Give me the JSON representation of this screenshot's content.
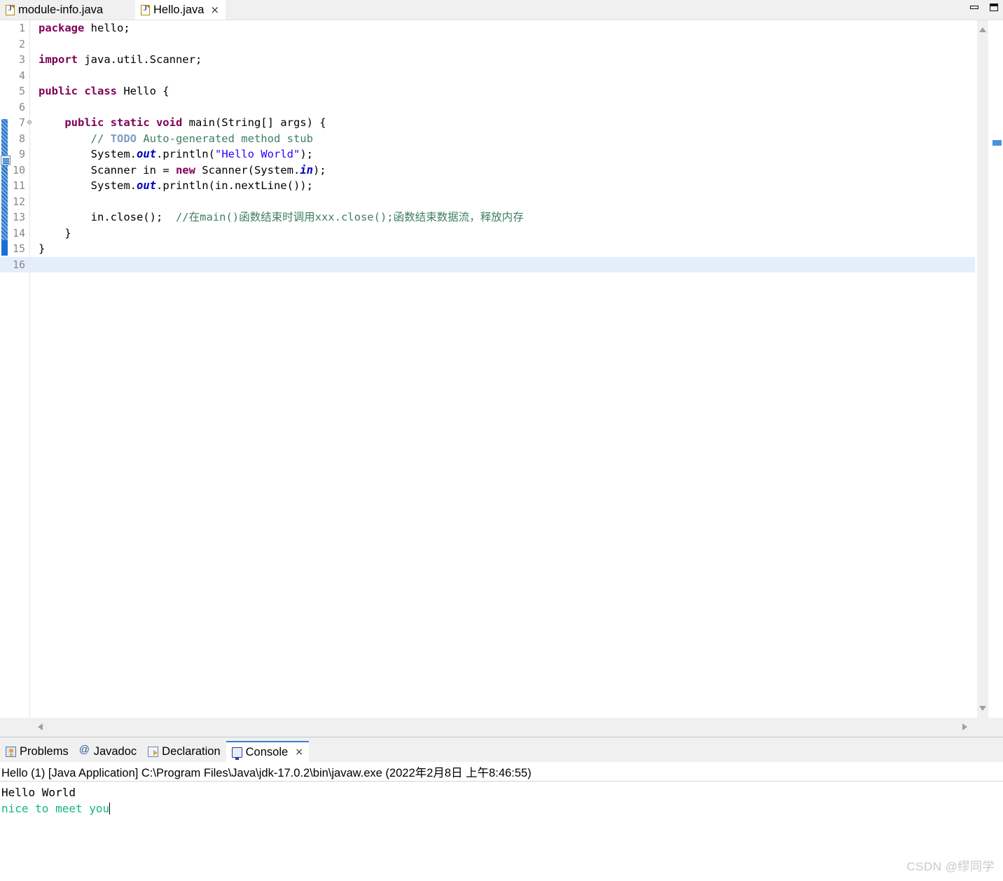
{
  "window": {
    "minimize_label": "Minimize",
    "maximize_label": "Maximize"
  },
  "editor_tabs": [
    {
      "label": "module-info.java",
      "icon": "java-file-icon",
      "active": false,
      "closable": false
    },
    {
      "label": "Hello.java",
      "icon": "java-file-icon",
      "active": true,
      "closable": true,
      "close_glyph": "×"
    }
  ],
  "editor": {
    "file": "Hello.java",
    "current_line": 16,
    "fold_marker": "⊖",
    "lines": [
      {
        "n": "1",
        "fold": "",
        "tokens": [
          {
            "t": "package",
            "c": "kw"
          },
          {
            "t": " hello;",
            "c": "plain"
          }
        ]
      },
      {
        "n": "2",
        "fold": "",
        "tokens": []
      },
      {
        "n": "3",
        "fold": "",
        "tokens": [
          {
            "t": "import",
            "c": "kw"
          },
          {
            "t": " java.util.Scanner;",
            "c": "plain"
          }
        ]
      },
      {
        "n": "4",
        "fold": "",
        "tokens": []
      },
      {
        "n": "5",
        "fold": "",
        "tokens": [
          {
            "t": "public class",
            "c": "kw"
          },
          {
            "t": " Hello {",
            "c": "plain"
          }
        ]
      },
      {
        "n": "6",
        "fold": "",
        "tokens": []
      },
      {
        "n": "7",
        "fold": "⊖",
        "tokens": [
          {
            "t": "    ",
            "c": "plain"
          },
          {
            "t": "public static void",
            "c": "kw"
          },
          {
            "t": " main(String[] args) {",
            "c": "plain"
          }
        ]
      },
      {
        "n": "8",
        "fold": "",
        "tokens": [
          {
            "t": "        ",
            "c": "plain"
          },
          {
            "t": "// ",
            "c": "cmt"
          },
          {
            "t": "TODO",
            "c": "todo"
          },
          {
            "t": " Auto-generated method stub",
            "c": "cmt"
          }
        ]
      },
      {
        "n": "9",
        "fold": "",
        "tokens": [
          {
            "t": "        System.",
            "c": "plain"
          },
          {
            "t": "out",
            "c": "fld"
          },
          {
            "t": ".println(",
            "c": "plain"
          },
          {
            "t": "\"Hello World\"",
            "c": "str"
          },
          {
            "t": ");",
            "c": "plain"
          }
        ]
      },
      {
        "n": "10",
        "fold": "",
        "tokens": [
          {
            "t": "        Scanner in = ",
            "c": "plain"
          },
          {
            "t": "new",
            "c": "kw"
          },
          {
            "t": " Scanner(System.",
            "c": "plain"
          },
          {
            "t": "in",
            "c": "fld"
          },
          {
            "t": ");",
            "c": "plain"
          }
        ]
      },
      {
        "n": "11",
        "fold": "",
        "tokens": [
          {
            "t": "        System.",
            "c": "plain"
          },
          {
            "t": "out",
            "c": "fld"
          },
          {
            "t": ".println(in.nextLine());",
            "c": "plain"
          }
        ]
      },
      {
        "n": "12",
        "fold": "",
        "tokens": []
      },
      {
        "n": "13",
        "fold": "",
        "tokens": [
          {
            "t": "        in.close();  ",
            "c": "plain"
          },
          {
            "t": "//在main()函数结束时调用xxx.close();函数结束数据流，释放内存",
            "c": "cmt"
          }
        ]
      },
      {
        "n": "14",
        "fold": "",
        "tokens": [
          {
            "t": "    }",
            "c": "plain"
          }
        ]
      },
      {
        "n": "15",
        "fold": "",
        "tokens": [
          {
            "t": "}",
            "c": "plain"
          }
        ]
      },
      {
        "n": "16",
        "fold": "",
        "tokens": []
      }
    ]
  },
  "scrollbars": {
    "vertical_up": "scroll-up",
    "vertical_down": "scroll-down",
    "horizontal_left": "scroll-left",
    "horizontal_right": "scroll-right"
  },
  "view_tabs": [
    {
      "label": "Problems",
      "icon": "problems-icon",
      "active": false,
      "closable": false
    },
    {
      "label": "Javadoc",
      "icon": "javadoc-icon",
      "active": false,
      "closable": false
    },
    {
      "label": "Declaration",
      "icon": "declaration-icon",
      "active": false,
      "closable": false
    },
    {
      "label": "Console",
      "icon": "console-icon",
      "active": true,
      "closable": true,
      "close_glyph": "×"
    }
  ],
  "console": {
    "launch_line": "Hello (1) [Java Application] C:\\Program Files\\Java\\jdk-17.0.2\\bin\\javaw.exe  (2022年2月8日 上午8:46:55)",
    "output_line": "Hello World",
    "input_line": "nice to meet you"
  },
  "watermark": "CSDN @缪同学",
  "colors": {
    "keyword": "#7f0055",
    "string": "#2a00ff",
    "comment": "#3f7f5f",
    "todo": "#7f9fbf",
    "field": "#0000c0",
    "console_input": "#16b47f",
    "current_line": "#e4eefb",
    "change_bar": "#1a6fd4"
  }
}
